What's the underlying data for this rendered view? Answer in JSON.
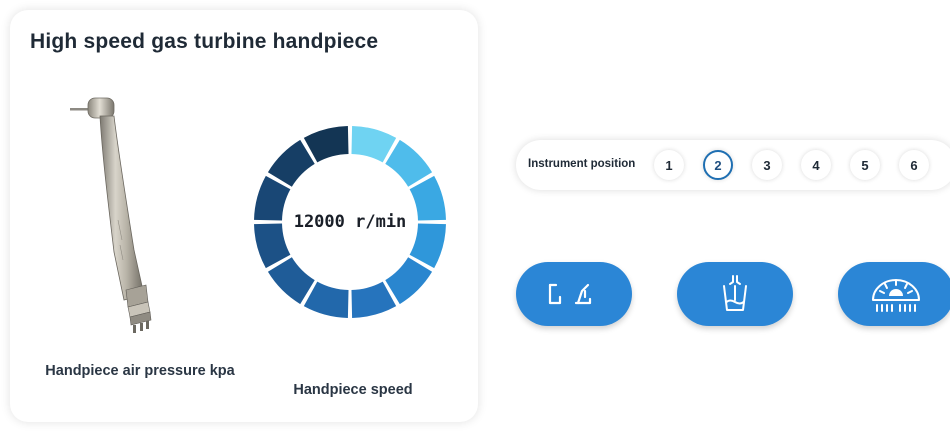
{
  "card": {
    "title": "High speed gas turbine handpiece",
    "pressure_label": "Handpiece air pressure kpa",
    "speed_label": "Handpiece speed",
    "speed_value": "12000 r/min",
    "gauge_segment_colors": [
      "#6fd3f2",
      "#4fbceb",
      "#3aa8e3",
      "#2f97da",
      "#2a86cf",
      "#2674bd",
      "#2268ab",
      "#1f5c98",
      "#1c5186",
      "#194775",
      "#163e65",
      "#133554"
    ]
  },
  "instrument": {
    "label": "Instrument position",
    "positions": [
      "1",
      "2",
      "3",
      "4",
      "5",
      "6"
    ],
    "selected": "2"
  },
  "actions": [
    {
      "icon": "chair-position-icon"
    },
    {
      "icon": "cup-fill-icon"
    },
    {
      "icon": "operating-light-icon"
    }
  ],
  "colors": {
    "accent": "#2b86d6",
    "selected_ring": "#1f6fb2"
  }
}
